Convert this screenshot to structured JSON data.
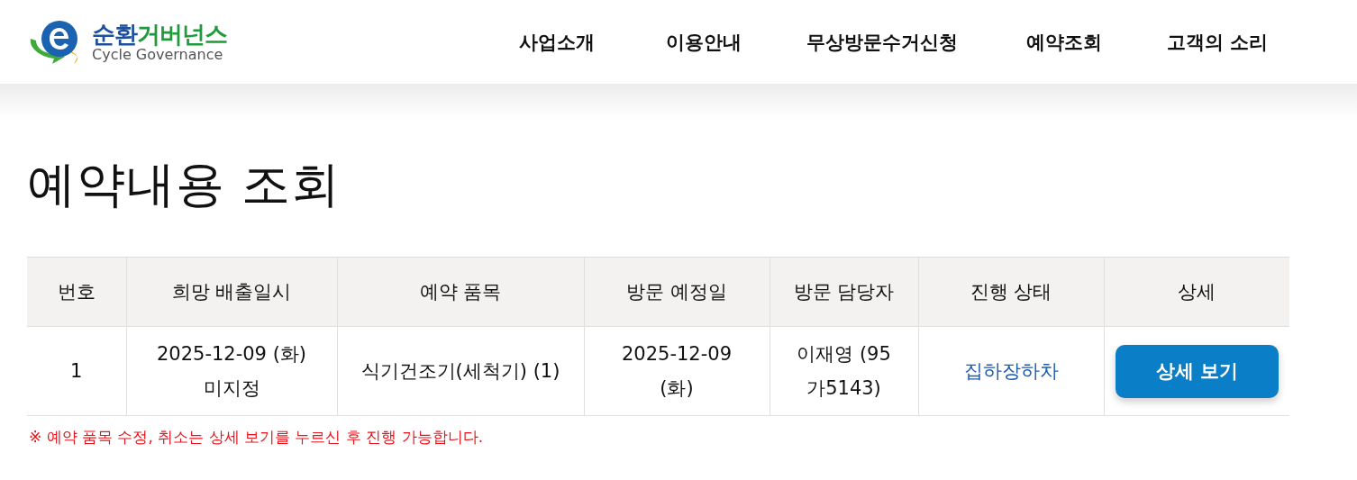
{
  "logo": {
    "title_primary": "순환",
    "title_secondary": "거버넌스",
    "subtitle": "Cycle Governance"
  },
  "nav": [
    "사업소개",
    "이용안내",
    "무상방문수거신청",
    "예약조회",
    "고객의 소리"
  ],
  "page_title": "예약내용 조회",
  "table": {
    "columns": [
      "번호",
      "희망 배출일시",
      "예약 품목",
      "방문 예정일",
      "방문 담당자",
      "진행 상태",
      "상세"
    ],
    "rows": [
      {
        "cells": [
          "1",
          "2025-12-09 (화)\n미지정",
          "식기건조기(세척기) (1)",
          "2025-12-09\n(화)",
          "이재영 (95\n가5143)",
          "집하장하차"
        ],
        "button": "상세 보기"
      }
    ]
  },
  "notice": "※ 예약 품목 수정, 취소는 상세 보기를 누르신 후 진행 가능합니다."
}
